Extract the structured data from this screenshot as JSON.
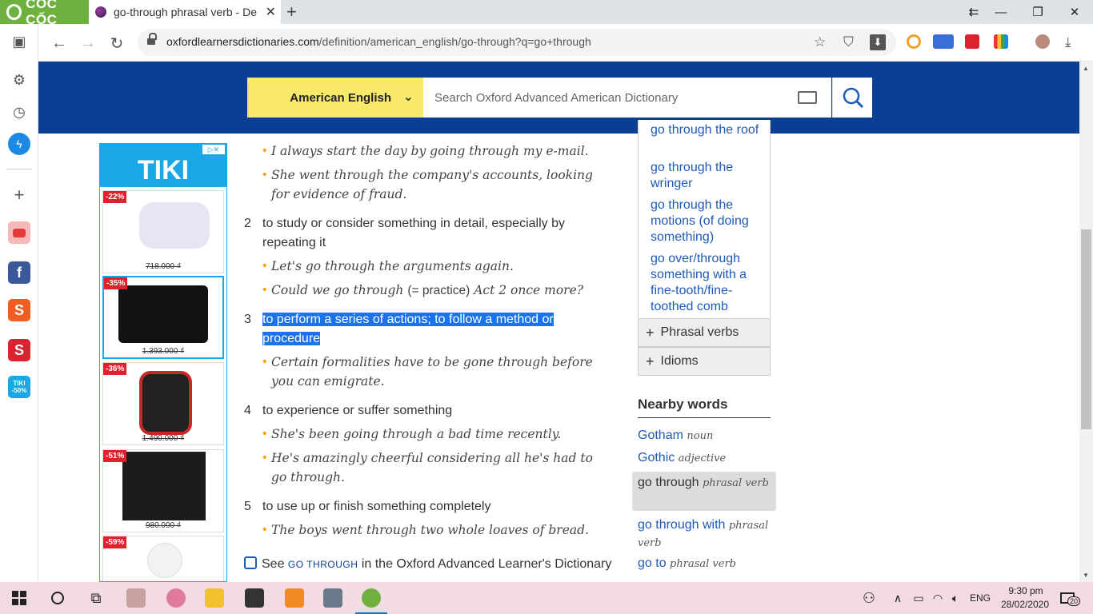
{
  "browser": {
    "brand": "CỐC CỐC",
    "active_tab_title": "go-through phrasal verb - De",
    "url_host": "oxfordlearnersdictionaries.com",
    "url_path": "/definition/american_english/go-through?q=go+through"
  },
  "header": {
    "dictionary_label": "American English",
    "search_placeholder": "Search Oxford Advanced American Dictionary"
  },
  "ad": {
    "brand": "TIKI",
    "products": [
      {
        "discount": "-22%",
        "price": "718.000 ₫"
      },
      {
        "discount": "-35%",
        "price": "1.393.000 ₫"
      },
      {
        "discount": "-36%",
        "price": "1.490.000 ₫"
      },
      {
        "discount": "-51%",
        "price": "980.000 ₫"
      },
      {
        "discount": "-59%",
        "price": ""
      }
    ]
  },
  "entry": {
    "senses": [
      {
        "num": "",
        "def": "",
        "examples": [
          "I always start the day by going through my e-mail.",
          "She went through the company's accounts, looking for evidence of fraud."
        ]
      },
      {
        "num": "2",
        "def": "to study or consider something in detail, especially by repeating it",
        "examples": [
          "Let's go through the arguments again.",
          "Could we go through"
        ]
      },
      {
        "num": "3",
        "def": "to perform a series of actions; to follow a method or procedure",
        "examples": [
          "Certain formalities have to be gone through before you can emigrate."
        ]
      },
      {
        "num": "4",
        "def": "to experience or suffer something",
        "examples": [
          "She's been going through a bad time recently.",
          "He's amazingly cheerful considering all he's had to go through."
        ]
      },
      {
        "num": "5",
        "def": "to use up or finish something completely",
        "examples": [
          "The boys went through two whole loaves of bread."
        ]
      }
    ],
    "example_gloss": "(= practice)",
    "example_tail": "Act 2 once more?",
    "see_label": "See",
    "see_word": "GO THROUGH",
    "see_rest": "in the Oxford Advanced Learner's Dictionary"
  },
  "sidebar": {
    "idioms": [
      "go through the roof",
      "go through the wringer",
      "go through the motions (of doing something)",
      "go over/through something with a fine-tooth/fine-toothed comb"
    ],
    "phrasal_verbs_label": "Phrasal verbs",
    "idioms_label": "Idioms",
    "nearby_title": "Nearby words",
    "nearby": [
      {
        "word": "Gotham",
        "pos": "noun"
      },
      {
        "word": "Gothic",
        "pos": "adjective"
      },
      {
        "word": "go through",
        "pos": "phrasal verb"
      },
      {
        "word": "go through with",
        "pos": "phrasal verb"
      },
      {
        "word": "go to",
        "pos": "phrasal verb"
      }
    ]
  },
  "taskbar": {
    "language": "ENG",
    "time": "9:30 pm",
    "date": "28/02/2020",
    "notifications": "20"
  },
  "icons": {
    "sidebar": [
      "panel-icon",
      "settings-icon",
      "history-icon",
      "messenger-icon",
      "add-icon",
      "youtube-icon",
      "facebook-icon",
      "shopee-icon",
      "sendo-icon",
      "tiki-icon"
    ]
  },
  "colors": {
    "oxford_blue": "#0b3f94",
    "dict_yellow": "#f9e969",
    "link_blue": "#1e5ab7",
    "highlight": "#1a73e8",
    "coccoc_green": "#6fb13f"
  }
}
